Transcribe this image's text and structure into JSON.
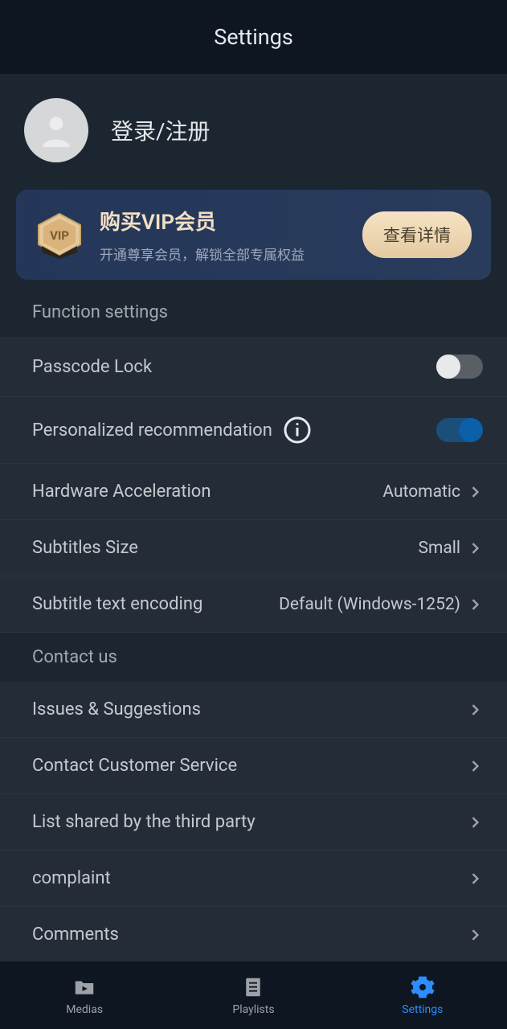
{
  "header": {
    "title": "Settings"
  },
  "profile": {
    "login_label": "登录/注册"
  },
  "vip": {
    "title": "购买VIP会员",
    "subtitle": "开通尊享会员，解锁全部专属权益",
    "button": "查看详情",
    "badge_text": "VIP"
  },
  "sections": {
    "function": "Function settings",
    "contact": "Contact us"
  },
  "settings": {
    "passcode": {
      "label": "Passcode Lock",
      "value": false
    },
    "personalized": {
      "label": "Personalized recommendation",
      "value": true
    },
    "hardware": {
      "label": "Hardware Acceleration",
      "value": "Automatic"
    },
    "subtitles_size": {
      "label": "Subtitles Size",
      "value": "Small"
    },
    "subtitle_encoding": {
      "label": "Subtitle text encoding",
      "value": "Default (Windows-1252)"
    }
  },
  "contact": {
    "issues": "Issues & Suggestions",
    "customer_service": "Contact Customer Service",
    "third_party": "List shared by the third party",
    "complaint": "complaint",
    "comments": "Comments"
  },
  "nav": {
    "medias": "Medias",
    "playlists": "Playlists",
    "settings": "Settings"
  }
}
